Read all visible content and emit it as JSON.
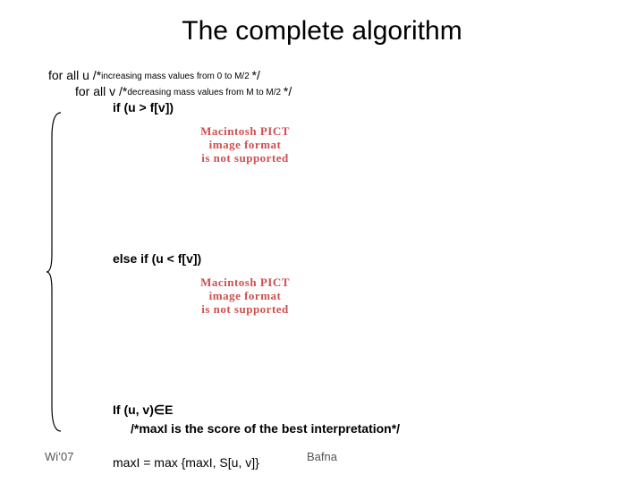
{
  "title": "The complete algorithm",
  "line1_prefix": "for all u /*",
  "line1_comment": "increasing mass values from 0 to M/2 ",
  "line1_suffix": "*/",
  "line2_prefix": "for all v /*",
  "line2_comment": "decreasing mass values from M to M/2 ",
  "line2_suffix": "*/",
  "line3": "if  (u > f[v])",
  "line4": "else if (u < f[v])",
  "line5": "If (u, v)∈E",
  "line5b": "/*maxI is the score of the best interpretation*/",
  "line6": "maxI = max {maxI, S[u, v]}",
  "pict_line1": "Macintosh PICT",
  "pict_line2": "image format",
  "pict_line3": "is not supported",
  "footer_left": "Wi’07",
  "footer_center": "Bafna"
}
